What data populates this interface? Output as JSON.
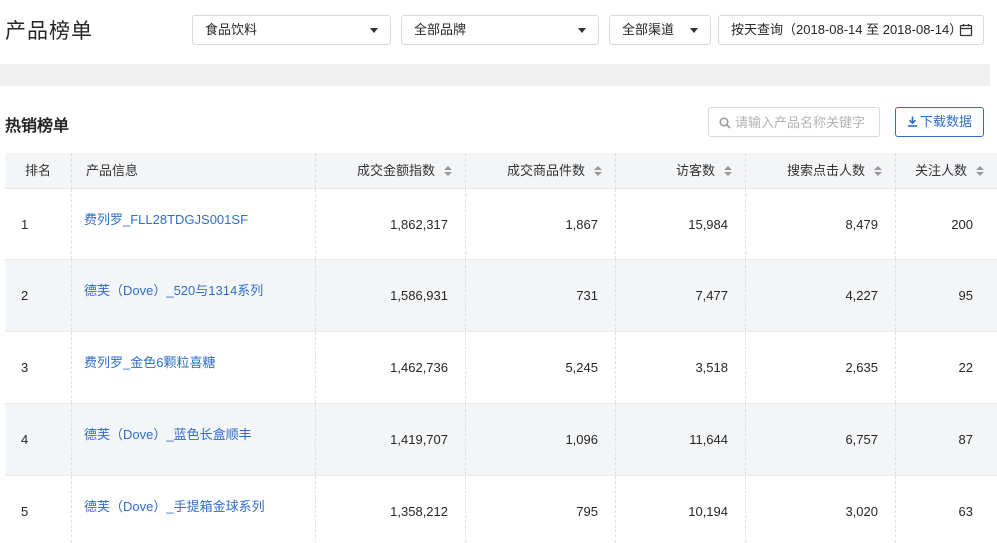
{
  "header": {
    "title": "产品榜单",
    "category_select": "食品饮料",
    "brand_select": "全部品牌",
    "channel_select": "全部渠道",
    "date_query": "按天查询（2018-08-14 至 2018-08-14）"
  },
  "section": {
    "title": "热销榜单",
    "search_placeholder": "请输入产品名称关键字",
    "download_label": "下载数据"
  },
  "table": {
    "columns": {
      "rank": "排名",
      "product": "产品信息",
      "amount_index": "成交金额指数",
      "items_sold": "成交商品件数",
      "visitors": "访客数",
      "search_clicks": "搜索点击人数",
      "followers": "关注人数"
    },
    "rows": [
      {
        "rank": "1",
        "product": "费列罗_FLL28TDGJS001SF",
        "amount_index": "1,862,317",
        "items_sold": "1,867",
        "visitors": "15,984",
        "search_clicks": "8,479",
        "followers": "200"
      },
      {
        "rank": "2",
        "product": "德芙（Dove）_520与1314系列",
        "amount_index": "1,586,931",
        "items_sold": "731",
        "visitors": "7,477",
        "search_clicks": "4,227",
        "followers": "95"
      },
      {
        "rank": "3",
        "product": "费列罗_金色6颗粒喜糖",
        "amount_index": "1,462,736",
        "items_sold": "5,245",
        "visitors": "3,518",
        "search_clicks": "2,635",
        "followers": "22"
      },
      {
        "rank": "4",
        "product": "德芙（Dove）_蓝色长盒顺丰",
        "amount_index": "1,419,707",
        "items_sold": "1,096",
        "visitors": "11,644",
        "search_clicks": "6,757",
        "followers": "87"
      },
      {
        "rank": "5",
        "product": "德芙（Dove）_手提箱金球系列",
        "amount_index": "1,358,212",
        "items_sold": "795",
        "visitors": "10,194",
        "search_clicks": "3,020",
        "followers": "63"
      }
    ]
  },
  "colors": {
    "link": "#2f6ec6",
    "header_bg": "#f4f5f7",
    "band_bg": "#f0f0f0"
  }
}
